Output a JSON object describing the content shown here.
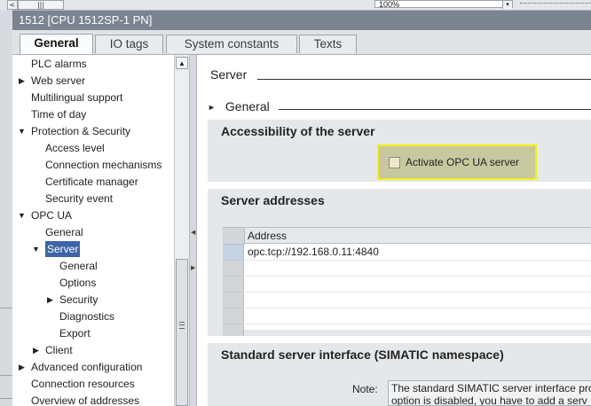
{
  "topbar": {
    "zoom_value": "100%",
    "left_btn_glyph": "<",
    "scroll_btn_glyph": "|||",
    "dropdown_glyph": "▾"
  },
  "window": {
    "title": "1512 [CPU 1512SP-1 PN]"
  },
  "tabs": [
    {
      "label": "General",
      "active": true
    },
    {
      "label": "IO tags",
      "active": false
    },
    {
      "label": "System constants",
      "active": false
    },
    {
      "label": "Texts",
      "active": false
    }
  ],
  "nav": {
    "items": [
      {
        "label": "PLC alarms",
        "level": 0,
        "expander": ""
      },
      {
        "label": "Web server",
        "level": 0,
        "expander": "collapsed"
      },
      {
        "label": "Multilingual support",
        "level": 0,
        "expander": ""
      },
      {
        "label": "Time of day",
        "level": 0,
        "expander": ""
      },
      {
        "label": "Protection & Security",
        "level": 0,
        "expander": "expanded"
      },
      {
        "label": "Access level",
        "level": 1,
        "expander": ""
      },
      {
        "label": "Connection mechanisms",
        "level": 1,
        "expander": ""
      },
      {
        "label": "Certificate manager",
        "level": 1,
        "expander": ""
      },
      {
        "label": "Security event",
        "level": 1,
        "expander": ""
      },
      {
        "label": "OPC UA",
        "level": 0,
        "expander": "expanded"
      },
      {
        "label": "General",
        "level": 1,
        "expander": ""
      },
      {
        "label": "Server",
        "level": 1,
        "expander": "expanded",
        "selected": true
      },
      {
        "label": "General",
        "level": 2,
        "expander": ""
      },
      {
        "label": "Options",
        "level": 2,
        "expander": ""
      },
      {
        "label": "Security",
        "level": 2,
        "expander": "collapsed"
      },
      {
        "label": "Diagnostics",
        "level": 2,
        "expander": ""
      },
      {
        "label": "Export",
        "level": 2,
        "expander": ""
      },
      {
        "label": "Client",
        "level": 1,
        "expander": "collapsed"
      },
      {
        "label": "Advanced configuration",
        "level": 0,
        "expander": "collapsed"
      },
      {
        "label": "Connection resources",
        "level": 0,
        "expander": ""
      },
      {
        "label": "Overview of addresses",
        "level": 0,
        "expander": ""
      }
    ]
  },
  "content": {
    "section_title": "Server",
    "subsection_title": "General",
    "accessibility": {
      "title": "Accessibility of the server",
      "checkbox_label": "Activate OPC UA server",
      "checked": false,
      "highlight_color": "#f2ef14"
    },
    "addresses": {
      "title": "Server addresses",
      "column_header": "Address",
      "rows": [
        "opc.tcp://192.168.0.11:4840",
        "",
        "",
        "",
        "",
        ""
      ]
    },
    "standard_interface": {
      "title": "Standard server interface (SIMATIC namespace)",
      "note_label": "Note:",
      "note_line1": "The standard SIMATIC server interface pro",
      "note_line2": "option is disabled, you have to add a serv"
    }
  },
  "colors": {
    "titlebar": "#7a858f",
    "selection": "#3e63a8",
    "panel": "#e5e8ea"
  }
}
